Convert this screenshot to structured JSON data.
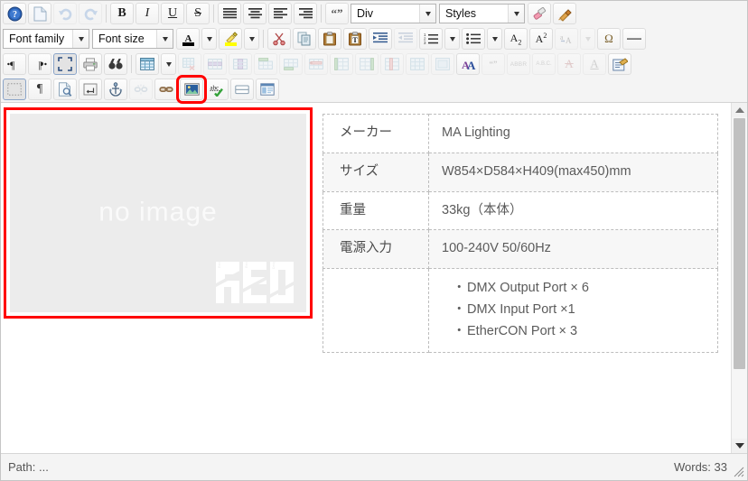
{
  "toolbar": {
    "row1": [
      {
        "name": "help-icon",
        "label": "?",
        "kind": "icon",
        "icon": "help"
      },
      {
        "name": "new-document-icon",
        "label": "",
        "kind": "icon",
        "icon": "page"
      },
      {
        "name": "undo-icon",
        "label": "",
        "kind": "icon",
        "icon": "undo",
        "disabled": true
      },
      {
        "name": "redo-icon",
        "label": "",
        "kind": "icon",
        "icon": "redo",
        "disabled": true
      },
      {
        "sep": true
      },
      {
        "name": "bold-icon",
        "label": "B",
        "kind": "text",
        "style": "bold"
      },
      {
        "name": "italic-icon",
        "label": "I",
        "kind": "text",
        "style": "italic"
      },
      {
        "name": "underline-icon",
        "label": "U",
        "kind": "text",
        "style": "underline"
      },
      {
        "name": "strikethrough-icon",
        "label": "S",
        "kind": "text",
        "style": "strike"
      },
      {
        "sep": true
      },
      {
        "name": "align-justify-icon",
        "label": "",
        "kind": "icon",
        "icon": "align-justify"
      },
      {
        "name": "align-center-icon",
        "label": "",
        "kind": "icon",
        "icon": "align-center"
      },
      {
        "name": "align-left-icon",
        "label": "",
        "kind": "icon",
        "icon": "align-left"
      },
      {
        "name": "align-right-icon",
        "label": "",
        "kind": "icon",
        "icon": "align-right"
      },
      {
        "sep": true
      },
      {
        "name": "blockquote-icon",
        "label": "“”",
        "kind": "quote"
      }
    ],
    "row2_icons": [
      {
        "name": "cut-icon",
        "icon": "scissors"
      },
      {
        "name": "copy-icon",
        "icon": "copy"
      },
      {
        "name": "paste-icon",
        "icon": "paste"
      },
      {
        "name": "paste-as-text-icon",
        "icon": "paste-text"
      },
      {
        "name": "indent-increase-icon",
        "icon": "indent"
      },
      {
        "name": "indent-decrease-icon",
        "icon": "outdent",
        "disabled": true
      },
      {
        "name": "numbered-list-icon",
        "icon": "numlist"
      },
      {
        "name": "numbered-list-dropdown-icon",
        "icon": "caret",
        "narrow": true
      },
      {
        "name": "bullet-list-icon",
        "icon": "bullist"
      },
      {
        "name": "bullet-list-dropdown-icon",
        "icon": "caret",
        "narrow": true
      },
      {
        "name": "subscript-icon",
        "icon": "sub"
      },
      {
        "name": "superscript-icon",
        "icon": "sup"
      },
      {
        "name": "spellcheck-lang-icon",
        "icon": "spell-a",
        "disabled": true
      },
      {
        "name": "spellcheck-dropdown-icon",
        "icon": "caret-gray",
        "narrow": true,
        "disabled": true
      },
      {
        "name": "special-character-icon",
        "icon": "omega"
      },
      {
        "name": "horizontal-rule-icon",
        "icon": "hr"
      }
    ],
    "row3_icons": [
      {
        "name": "ltr-direction-icon",
        "icon": "pilcrow-ltr"
      },
      {
        "name": "rtl-direction-icon",
        "icon": "pilcrow-rtl"
      },
      {
        "name": "fullscreen-icon",
        "icon": "fullscreen",
        "framed": true
      },
      {
        "name": "print-icon",
        "icon": "printer"
      },
      {
        "name": "search-replace-icon",
        "icon": "binoculars"
      },
      {
        "sep": true
      },
      {
        "name": "insert-table-icon",
        "icon": "table"
      },
      {
        "name": "insert-table-dropdown-icon",
        "icon": "caret-black",
        "narrow": true
      },
      {
        "name": "delete-table-icon",
        "icon": "table-del",
        "disabled": true
      },
      {
        "name": "table-row-properties-icon",
        "icon": "table-row-props",
        "disabled": true
      },
      {
        "name": "table-cell-properties-icon",
        "icon": "table-cell-props",
        "disabled": true
      },
      {
        "name": "insert-row-before-icon",
        "icon": "row-before",
        "disabled": true
      },
      {
        "name": "insert-row-after-icon",
        "icon": "row-after",
        "disabled": true
      },
      {
        "name": "delete-row-icon",
        "icon": "row-del",
        "disabled": true
      },
      {
        "name": "insert-column-before-icon",
        "icon": "col-before",
        "disabled": true
      },
      {
        "name": "insert-column-after-icon",
        "icon": "col-after",
        "disabled": true
      },
      {
        "name": "delete-column-icon",
        "icon": "col-del",
        "disabled": true
      },
      {
        "name": "split-cells-icon",
        "icon": "split-cells",
        "disabled": true
      },
      {
        "name": "merge-cells-icon",
        "icon": "merge-cells",
        "disabled": true
      },
      {
        "name": "replace-font-icon",
        "icon": "font-AA"
      },
      {
        "name": "insert-quote-icon",
        "icon": "quote-6699",
        "disabled": true
      },
      {
        "name": "abbreviation-icon",
        "icon": "abbr",
        "disabled": true
      },
      {
        "name": "acronym-icon",
        "icon": "acronym",
        "disabled": true
      },
      {
        "name": "delete-tag-icon",
        "icon": "del-A",
        "disabled": true
      },
      {
        "name": "insert-tag-icon",
        "icon": "ins-A",
        "disabled": true
      },
      {
        "name": "attributes-icon",
        "icon": "attributes"
      }
    ],
    "row4_icons": [
      {
        "name": "show-blocks-icon",
        "icon": "visualblocks",
        "pressed": true
      },
      {
        "name": "invisible-characters-icon",
        "icon": "pilcrow"
      },
      {
        "name": "preview-icon",
        "icon": "preview"
      },
      {
        "name": "insert-page-break-icon",
        "icon": "pagebreak"
      },
      {
        "name": "insert-anchor-icon",
        "icon": "anchor"
      },
      {
        "name": "unlink-icon",
        "icon": "unlink",
        "disabled": true
      },
      {
        "name": "insert-link-icon",
        "icon": "link"
      },
      {
        "name": "insert-image-icon",
        "icon": "image",
        "highlighted": true
      },
      {
        "name": "spellchecker-icon",
        "icon": "abc-check"
      },
      {
        "name": "insert-horizontal-rule-icon",
        "icon": "hr-box"
      },
      {
        "name": "template-icon",
        "icon": "template"
      }
    ]
  },
  "selects": {
    "font_family_label": "Font family",
    "font_size_label": "Font size",
    "block_format_label": "Div",
    "styles_label": "Styles"
  },
  "color_buttons": {
    "text_color_name": "text-color-icon",
    "text_color": "#000000",
    "background_color_name": "highlight-color-icon",
    "background_color": "#ffff00",
    "eraser_name": "remove-format-icon",
    "cleanup_name": "cleanup-icon"
  },
  "content": {
    "image_placeholder": {
      "caption": "no image",
      "watermark": "RED",
      "watermark_sub": [
        "Rent",
        "Rental",
        "Design"
      ]
    },
    "table": {
      "rows": [
        {
          "key": "メーカー",
          "value": "MA Lighting",
          "alt": false
        },
        {
          "key": "サイズ",
          "value": "W854×D584×H409(max450)mm",
          "alt": true
        },
        {
          "key": "重量",
          "value": "33kg（本体）",
          "alt": false
        },
        {
          "key": "電源入力",
          "value": "100-240V 50/60Hz",
          "alt": true
        },
        {
          "key": "",
          "value": "",
          "alt": false,
          "list": [
            "DMX Output Port × 6",
            "DMX Input Port ×1",
            "EtherCON Port × 3"
          ]
        }
      ]
    }
  },
  "statusbar": {
    "path_label": "Path: ...",
    "word_count": "Words: 33",
    "resize_handle_name": "resize-handle"
  },
  "colors": {
    "highlight_red": "#ff0000",
    "toolbar_bg": "#f4f4f4",
    "placeholder_bg": "#ececec",
    "text_gray": "#5b5b5b"
  }
}
